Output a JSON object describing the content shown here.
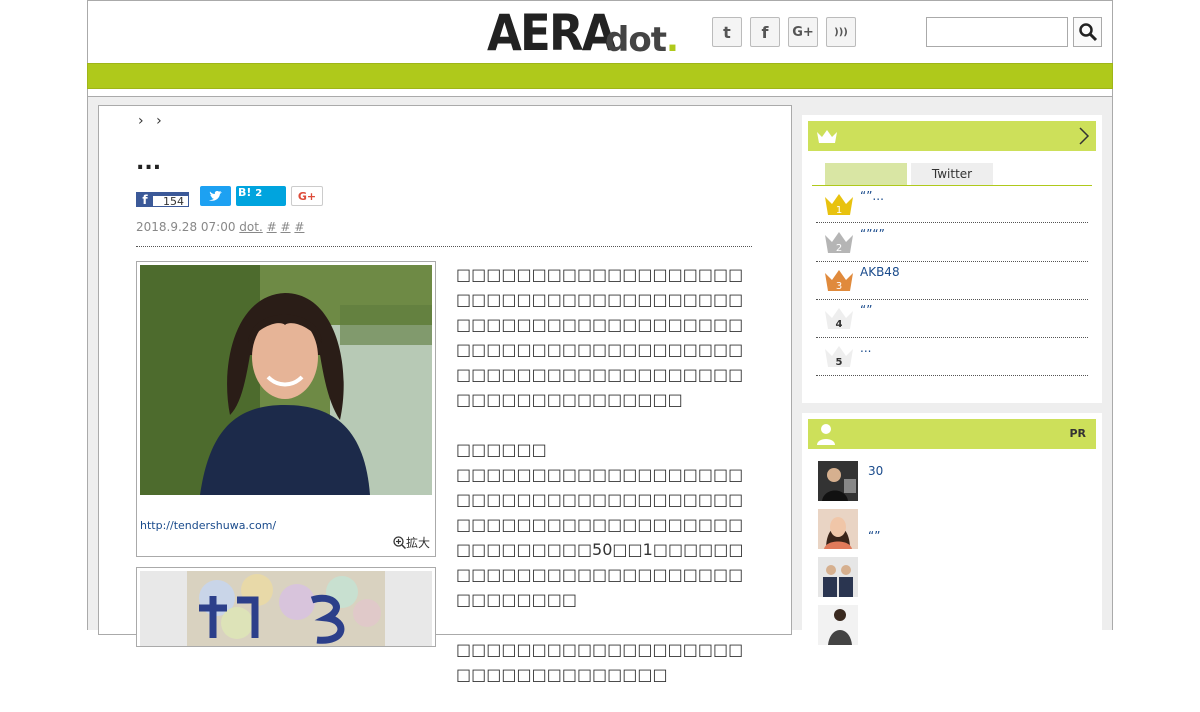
{
  "header": {
    "logo_main": "AERA",
    "logo_sub_a": "dot",
    "logo_sub_b": ".",
    "social": [
      {
        "icon": "twitter-icon",
        "glyph": "t"
      },
      {
        "icon": "facebook-icon",
        "glyph": "f"
      },
      {
        "icon": "google-plus-icon",
        "glyph": "G+"
      },
      {
        "icon": "rss-icon",
        "glyph": ")))"
      }
    ],
    "search_placeholder": ""
  },
  "article": {
    "breadcrumb": [
      "›",
      "›"
    ],
    "title": "...",
    "share": {
      "facebook_count": "154",
      "hatena_label": "B!",
      "hatena_count": "2",
      "gplus_label": "G+"
    },
    "date": "2018.9.28 07:00",
    "source": "dot.",
    "tags": [
      "#",
      "#",
      "#"
    ],
    "photo_caption": "http://tendershuwa.com/",
    "zoom_label": "拡大",
    "paragraphs": [
      "□□□□□□□□□□□□□□□□□□□□□□□□□□□□□□□□□□□□□□□□□□□□□□□□□□□□□□□□□□□□□□□□□□□□□□□□□□□□□□□□□□□□□□□□□□□□□□□□□□□□□□□□□□□□□□",
      "□□□□□□\n□□□□□□□□□□□□□□□□□□□□□□□□□□□□□□□□□□□□□□□□□□□□□□□□□□□□□□□□□□□□□□□□□□50□□1□□□□□□□□□□□□□□□□□□□□□□□□□□□□□□□□□",
      "□□□□□□□□□□□□□□□□□□□□□□□□□□□□□□□□□"
    ]
  },
  "sidebar": {
    "ranking": {
      "tabs": [
        "",
        "Twitter"
      ],
      "items": [
        {
          "rank": "1",
          "text": "“”..."
        },
        {
          "rank": "2",
          "text": "“”“”"
        },
        {
          "rank": "3",
          "text": "AKB48"
        },
        {
          "rank": "4",
          "text": "“”"
        },
        {
          "rank": "5",
          "text": "..."
        }
      ]
    },
    "pr": {
      "label": "PR",
      "items": [
        {
          "text": "30"
        },
        {
          "text": "“”"
        },
        {
          "text": ""
        },
        {
          "text": ""
        }
      ]
    }
  },
  "colors": {
    "accent": "#afc91b",
    "sidebar_head": "#cde05a",
    "link": "#1a4b8c"
  }
}
